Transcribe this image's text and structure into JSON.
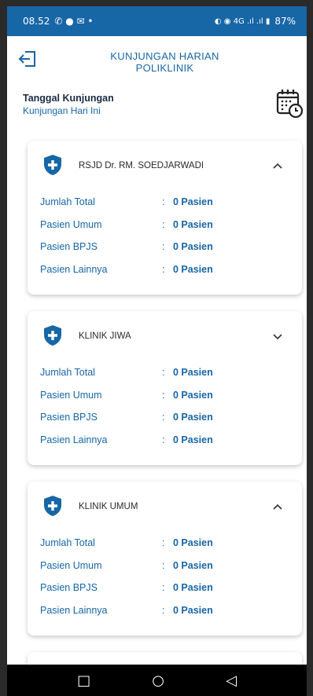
{
  "statusbar": {
    "time": "08.52",
    "apps": "✆ ● ✉ •",
    "signal": "◐ ◉ 4G .ıl .ıl ▮",
    "battery": "87%"
  },
  "header": {
    "title_line1": "KUNJUNGAN HARIAN",
    "title_line2": "POLIKLINIK"
  },
  "date": {
    "label": "Tanggal Kunjungan",
    "value": "Kunjungan Hari Ini"
  },
  "cards": [
    {
      "name": "RSJD Dr. RM. SOEDJARWADI",
      "expanded": true,
      "rows": [
        {
          "key": "Jumlah Total",
          "value": "0 Pasien"
        },
        {
          "key": "Pasien Umum",
          "value": "0 Pasien"
        },
        {
          "key": "Pasien BPJS",
          "value": "0 Pasien"
        },
        {
          "key": "Pasien Lainnya",
          "value": "0 Pasien"
        }
      ]
    },
    {
      "name": "KLINIK JIWA",
      "expanded": false,
      "rows": [
        {
          "key": "Jumlah Total",
          "value": "0 Pasien"
        },
        {
          "key": "Pasien Umum",
          "value": "0 Pasien"
        },
        {
          "key": "Pasien BPJS",
          "value": "0 Pasien"
        },
        {
          "key": "Pasien Lainnya",
          "value": "0 Pasien"
        }
      ]
    },
    {
      "name": "KLINIK UMUM",
      "expanded": true,
      "rows": [
        {
          "key": "Jumlah Total",
          "value": "0 Pasien"
        },
        {
          "key": "Pasien Umum",
          "value": "0 Pasien"
        },
        {
          "key": "Pasien BPJS",
          "value": "0 Pasien"
        },
        {
          "key": "Pasien Lainnya",
          "value": "0 Pasien"
        }
      ]
    }
  ],
  "colon": ":",
  "navbar": {
    "recents": "□",
    "home": "○",
    "back": "◁"
  },
  "colors": {
    "primary": "#1766a6",
    "statusbar": "#1766a6"
  },
  "icons": {
    "back": "back-arrow-icon",
    "calendar": "calendar-clock-icon",
    "card": "shield-plus-icon",
    "collapse": "chevron-up-icon",
    "expand": "chevron-down-icon"
  }
}
